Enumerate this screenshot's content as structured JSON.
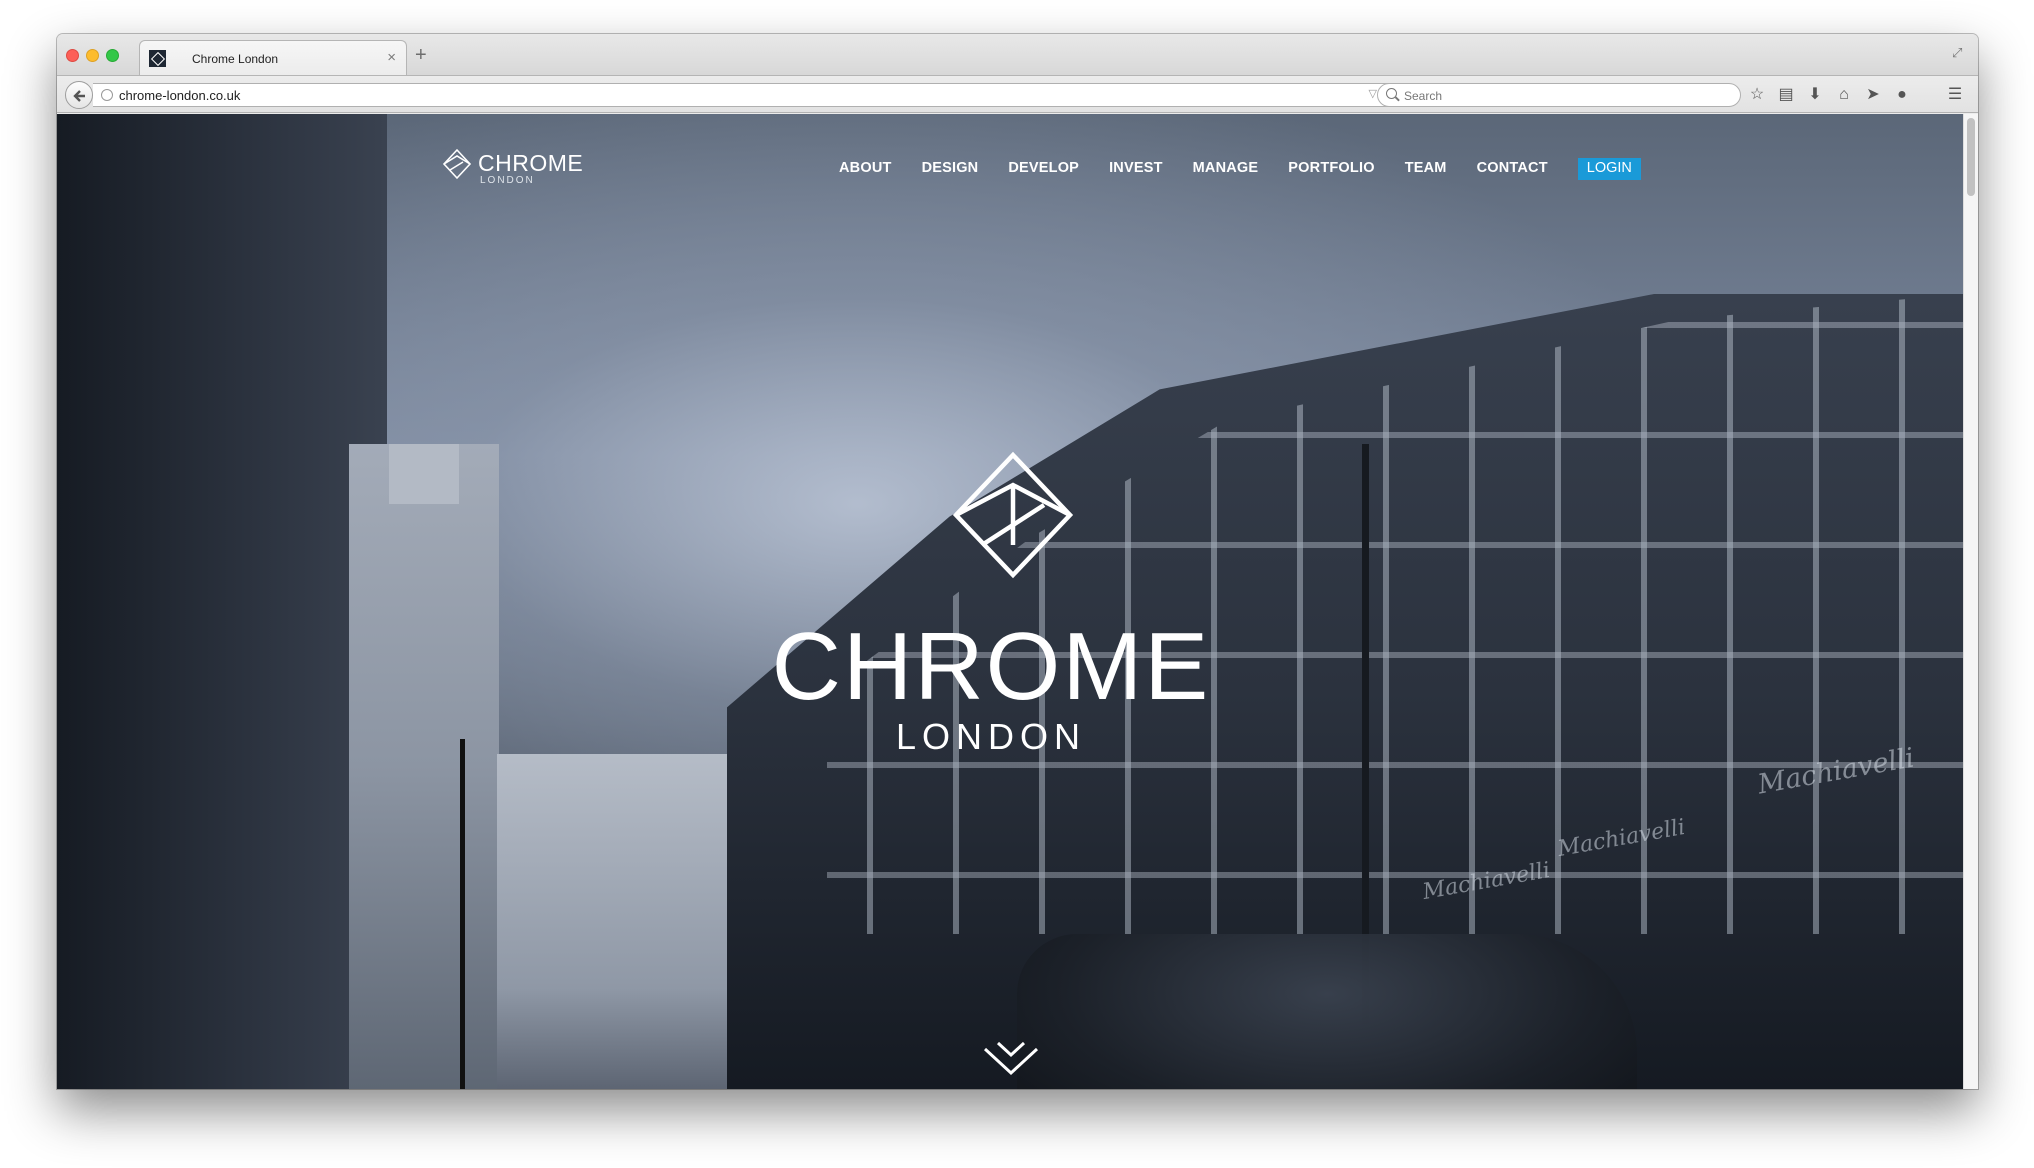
{
  "browser": {
    "tab_title": "Chrome London",
    "url": "chrome-london.co.uk",
    "search_placeholder": "Search",
    "icons": [
      "back-icon",
      "reload-icon",
      "star-icon",
      "reader-icon",
      "download-icon",
      "home-icon",
      "send-icon",
      "chat-icon",
      "menu-icon"
    ]
  },
  "site": {
    "logo_name": "CHROME",
    "logo_sub": "LONDON",
    "nav": [
      {
        "label": "ABOUT"
      },
      {
        "label": "DESIGN"
      },
      {
        "label": "DEVELOP"
      },
      {
        "label": "INVEST"
      },
      {
        "label": "MANAGE"
      },
      {
        "label": "PORTFOLIO"
      },
      {
        "label": "TEAM"
      },
      {
        "label": "CONTACT"
      }
    ],
    "login_label": "LOGIN",
    "hero_title": "CHROME",
    "hero_subtitle": "LONDON",
    "signs": [
      "Machiavelli",
      "Machiavelli",
      "Machiavelli"
    ]
  },
  "colors": {
    "login_accent": "#1a9ad8",
    "hero_text": "#ffffff"
  }
}
